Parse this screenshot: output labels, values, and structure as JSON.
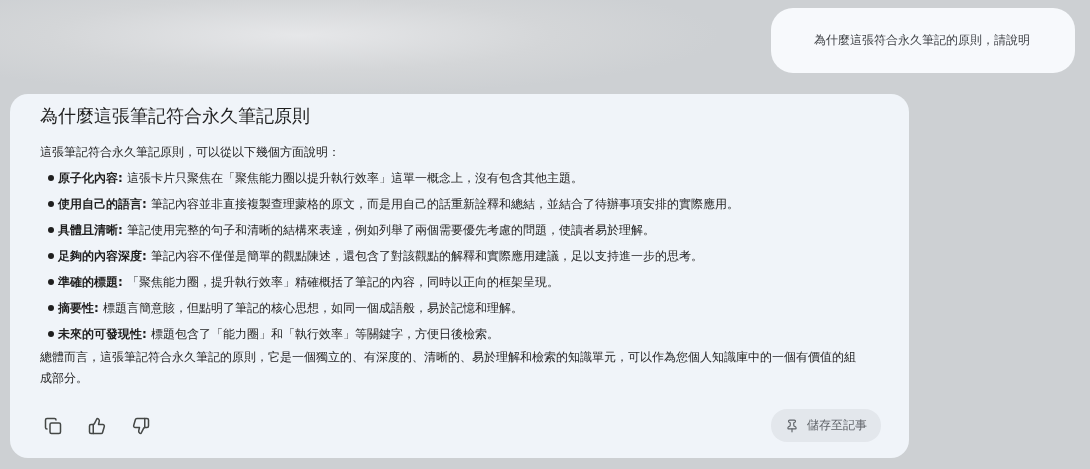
{
  "user_message": "為什麼這張符合永久筆記的原則，請說明",
  "response": {
    "title": "為什麼這張筆記符合永久筆記原則",
    "intro": "這張筆記符合永久筆記原則，可以從以下幾個方面說明：",
    "points": [
      {
        "label": "原子化內容:",
        "text": "這張卡片只聚焦在「聚焦能力圈以提升執行效率」這單一概念上，沒有包含其他主題。"
      },
      {
        "label": "使用自己的語言:",
        "text": "筆記內容並非直接複製查理蒙格的原文，而是用自己的話重新詮釋和總結，並結合了待辦事項安排的實際應用。"
      },
      {
        "label": "具體且清晰:",
        "text": "筆記使用完整的句子和清晰的結構來表達，例如列舉了兩個需要優先考慮的問題，使讀者易於理解。"
      },
      {
        "label": "足夠的內容深度:",
        "text": "筆記內容不僅僅是簡單的觀點陳述，還包含了對該觀點的解釋和實際應用建議，足以支持進一步的思考。"
      },
      {
        "label": "準確的標題:",
        "text": "「聚焦能力圈，提升執行效率」精確概括了筆記的內容，同時以正向的框架呈現。"
      },
      {
        "label": "摘要性:",
        "text": "標題言簡意賅，但點明了筆記的核心思想，如同一個成語般，易於記憶和理解。"
      },
      {
        "label": "未來的可發現性:",
        "text": "標題包含了「能力圈」和「執行效率」等關鍵字，方便日後檢索。"
      }
    ],
    "conclusion": "總體而言，這張筆記符合永久筆記的原則，它是一個獨立的、有深度的、清晰的、易於理解和檢索的知識單元，可以作為您個人知識庫中的一個有價值的組成部分。",
    "save_button": "儲存至記事"
  }
}
